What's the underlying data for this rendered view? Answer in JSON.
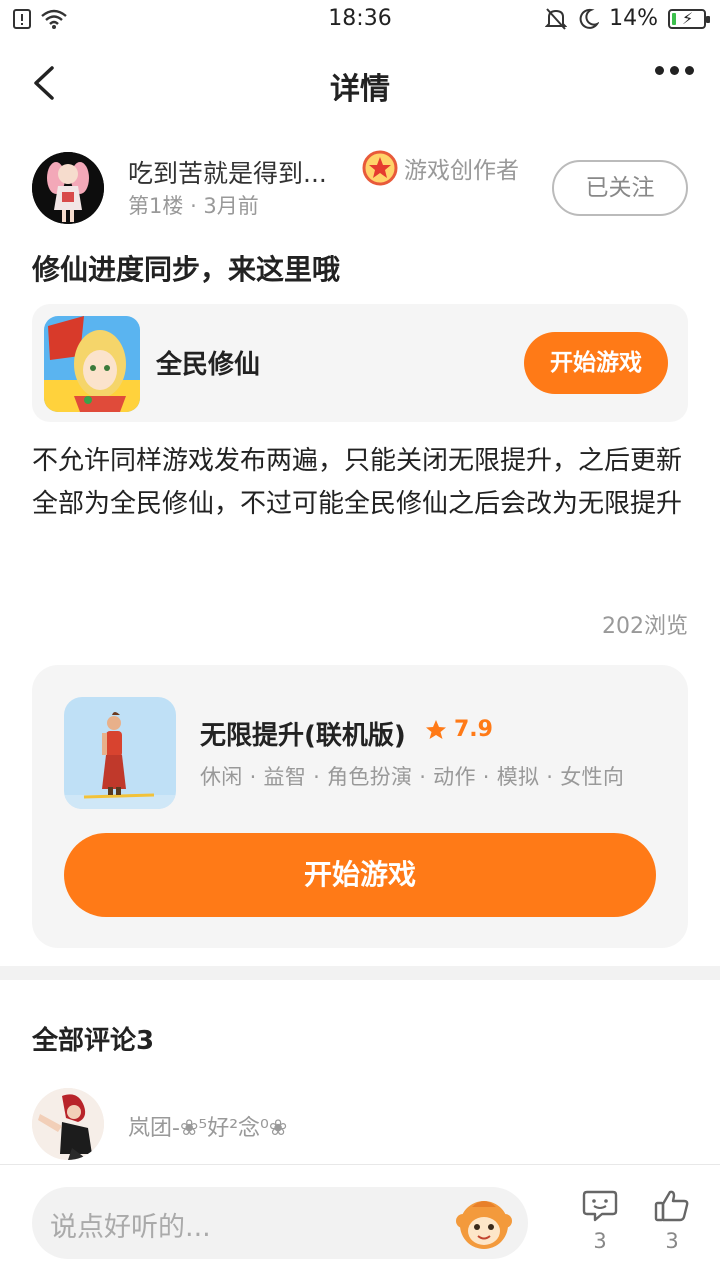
{
  "status_bar": {
    "time": "18:36",
    "battery": "14%",
    "battery_level": 0.14,
    "icons": [
      "alert-icon",
      "wifi-icon",
      "mute-icon",
      "moon-icon",
      "battery-icon"
    ]
  },
  "nav": {
    "title": "详情",
    "back_icon": "chevron-left-icon",
    "more_icon": "more-dots-icon"
  },
  "post": {
    "author_name": "吃到苦就是得到...",
    "creator_badge": "游戏创作者",
    "floor": "第1楼",
    "time_ago": "3月前",
    "follow_label": "已关注",
    "title": "修仙进度同步，来这里哦",
    "body": "不允许同样游戏发布两遍，只能关闭无限提升，之后更新全部为全民修仙，不过可能全民修仙之后会改为无限提升",
    "views": "202浏览"
  },
  "linked_game": {
    "name": "全民修仙",
    "play_label": "开始游戏"
  },
  "game_card": {
    "name": "无限提升(联机版)",
    "rating": "7.9",
    "tags": "休闲 · 益智 · 角色扮演 · 动作 · 模拟 · 女性向",
    "play_label": "开始游戏"
  },
  "comments": {
    "title": "全部评论3",
    "items": [
      {
        "user": "岚团-❀⁵好²念⁰❀"
      }
    ]
  },
  "bottom_bar": {
    "placeholder": "说点好听的...",
    "comment_count": "3",
    "like_count": "3"
  },
  "colors": {
    "accent": "#ff7a17",
    "card_bg": "#f5f5f5",
    "muted_text": "#999999"
  }
}
